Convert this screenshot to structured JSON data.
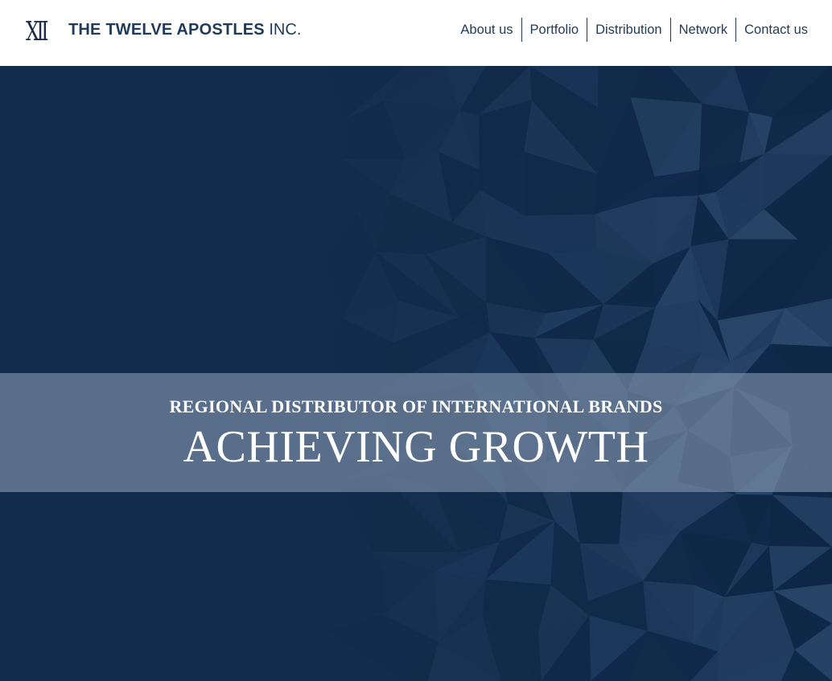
{
  "header": {
    "logo_mark": "XII",
    "brand_name": "THE TWELVE APOSTLES",
    "brand_suffix": "INC."
  },
  "nav": {
    "items": [
      {
        "label": "About us"
      },
      {
        "label": "Portfolio"
      },
      {
        "label": "Distribution"
      },
      {
        "label": "Network"
      },
      {
        "label": "Contact us"
      }
    ]
  },
  "hero": {
    "subtitle": "REGIONAL DISTRIBUTOR OF INTERNATIONAL BRANDS",
    "title": "ACHIEVING GROWTH"
  },
  "colors": {
    "navy": "#122c4d",
    "brand_text": "#1f3b5a",
    "banner_overlay": "#8497b0"
  }
}
